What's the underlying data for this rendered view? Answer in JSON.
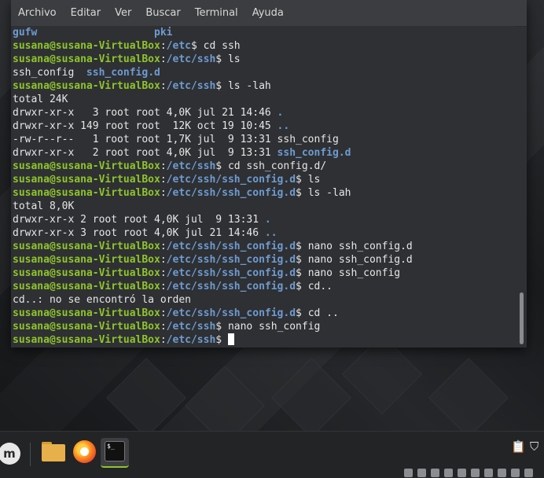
{
  "menubar": {
    "items": [
      "Archivo",
      "Editar",
      "Ver",
      "Buscar",
      "Terminal",
      "Ayuda"
    ]
  },
  "terminal": {
    "lines": [
      [
        [
          "d",
          "gufw"
        ],
        [
          "t",
          "                   "
        ],
        [
          "d",
          "pki"
        ]
      ],
      [
        [
          "u",
          "susana@susana-VirtualBox"
        ],
        [
          "t",
          ":"
        ],
        [
          "p",
          "/etc"
        ],
        [
          "t",
          "$ cd ssh"
        ]
      ],
      [
        [
          "u",
          "susana@susana-VirtualBox"
        ],
        [
          "t",
          ":"
        ],
        [
          "p",
          "/etc/ssh"
        ],
        [
          "t",
          "$ ls"
        ]
      ],
      [
        [
          "t",
          "ssh_config  "
        ],
        [
          "d",
          "ssh_config.d"
        ]
      ],
      [
        [
          "u",
          "susana@susana-VirtualBox"
        ],
        [
          "t",
          ":"
        ],
        [
          "p",
          "/etc/ssh"
        ],
        [
          "t",
          "$ ls -lah"
        ]
      ],
      [
        [
          "t",
          "total 24K"
        ]
      ],
      [
        [
          "t",
          "drwxr-xr-x   3 root root 4,0K jul 21 14:46 "
        ],
        [
          "d",
          "."
        ]
      ],
      [
        [
          "t",
          "drwxr-xr-x 149 root root  12K oct 19 10:45 "
        ],
        [
          "d",
          ".."
        ]
      ],
      [
        [
          "t",
          "-rw-r--r--   1 root root 1,7K jul  9 13:31 ssh_config"
        ]
      ],
      [
        [
          "t",
          "drwxr-xr-x   2 root root 4,0K jul  9 13:31 "
        ],
        [
          "d",
          "ssh_config.d"
        ]
      ],
      [
        [
          "u",
          "susana@susana-VirtualBox"
        ],
        [
          "t",
          ":"
        ],
        [
          "p",
          "/etc/ssh"
        ],
        [
          "t",
          "$ cd ssh_config.d/"
        ]
      ],
      [
        [
          "u",
          "susana@susana-VirtualBox"
        ],
        [
          "t",
          ":"
        ],
        [
          "p",
          "/etc/ssh/ssh_config.d"
        ],
        [
          "t",
          "$ ls"
        ]
      ],
      [
        [
          "u",
          "susana@susana-VirtualBox"
        ],
        [
          "t",
          ":"
        ],
        [
          "p",
          "/etc/ssh/ssh_config.d"
        ],
        [
          "t",
          "$ ls -lah"
        ]
      ],
      [
        [
          "t",
          "total 8,0K"
        ]
      ],
      [
        [
          "t",
          "drwxr-xr-x 2 root root 4,0K jul  9 13:31 "
        ],
        [
          "d",
          "."
        ]
      ],
      [
        [
          "t",
          "drwxr-xr-x 3 root root 4,0K jul 21 14:46 "
        ],
        [
          "d",
          ".."
        ]
      ],
      [
        [
          "u",
          "susana@susana-VirtualBox"
        ],
        [
          "t",
          ":"
        ],
        [
          "p",
          "/etc/ssh/ssh_config.d"
        ],
        [
          "t",
          "$ nano ssh_config.d"
        ]
      ],
      [
        [
          "u",
          "susana@susana-VirtualBox"
        ],
        [
          "t",
          ":"
        ],
        [
          "p",
          "/etc/ssh/ssh_config.d"
        ],
        [
          "t",
          "$ nano ssh_config.d"
        ]
      ],
      [
        [
          "u",
          "susana@susana-VirtualBox"
        ],
        [
          "t",
          ":"
        ],
        [
          "p",
          "/etc/ssh/ssh_config.d"
        ],
        [
          "t",
          "$ nano ssh_config"
        ]
      ],
      [
        [
          "u",
          "susana@susana-VirtualBox"
        ],
        [
          "t",
          ":"
        ],
        [
          "p",
          "/etc/ssh/ssh_config.d"
        ],
        [
          "t",
          "$ cd.."
        ]
      ],
      [
        [
          "t",
          "cd..: no se encontró la orden"
        ]
      ],
      [
        [
          "u",
          "susana@susana-VirtualBox"
        ],
        [
          "t",
          ":"
        ],
        [
          "p",
          "/etc/ssh/ssh_config.d"
        ],
        [
          "t",
          "$ cd .."
        ]
      ],
      [
        [
          "u",
          "susana@susana-VirtualBox"
        ],
        [
          "t",
          ":"
        ],
        [
          "p",
          "/etc/ssh"
        ],
        [
          "t",
          "$ nano ssh_config"
        ]
      ],
      [
        [
          "u",
          "susana@susana-VirtualBox"
        ],
        [
          "t",
          ":"
        ],
        [
          "p",
          "/etc/ssh"
        ],
        [
          "t",
          "$ "
        ]
      ]
    ]
  },
  "taskbar": {
    "start_icon": "linux-mint-logo-icon",
    "start_glyph": "m",
    "launchers": [
      "files-folder-icon",
      "firefox-icon",
      "terminal-icon"
    ],
    "terminal_glyph": "$_",
    "tray": [
      "clipboard-icon",
      "shield-icon"
    ],
    "tray_glyphs": [
      "📋",
      "⛉"
    ]
  },
  "colors": {
    "user_host": "#8ec52b",
    "path": "#6d9bd1",
    "directory": "#6d9bd1",
    "text": "#e6e6e6",
    "terminal_bg": "#2f3033"
  }
}
